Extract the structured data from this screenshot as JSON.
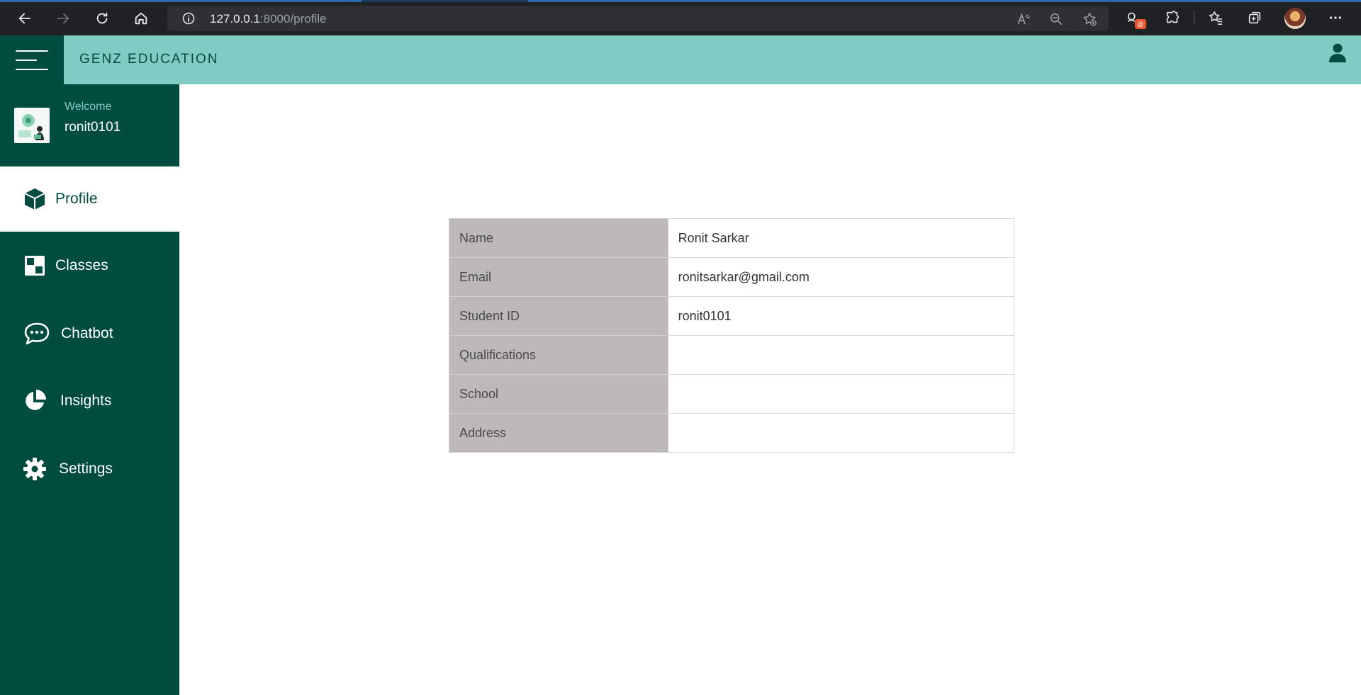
{
  "browser": {
    "url_host": "127.0.0.1",
    "url_path": ":8000/profile",
    "extension_badge": "@"
  },
  "header": {
    "brand": "GENZ EDUCATION"
  },
  "sidebar": {
    "welcome_label": "Welcome",
    "username": "ronit0101",
    "items": [
      {
        "label": "Profile",
        "icon": "cube-icon",
        "active": true
      },
      {
        "label": "Classes",
        "icon": "classes-icon"
      },
      {
        "label": "Chatbot",
        "icon": "chat-icon"
      },
      {
        "label": "Insights",
        "icon": "pie-chart-icon"
      },
      {
        "label": "Settings",
        "icon": "gear-icon"
      }
    ]
  },
  "profile": {
    "rows": [
      {
        "key": "Name",
        "value": "Ronit Sarkar"
      },
      {
        "key": "Email",
        "value": "ronitsarkar@gmail.com"
      },
      {
        "key": "Student ID",
        "value": "ronit0101"
      },
      {
        "key": "Qualifications",
        "value": ""
      },
      {
        "key": "School",
        "value": ""
      },
      {
        "key": "Address",
        "value": ""
      }
    ]
  },
  "colors": {
    "sidebar": "#004d40",
    "header": "#80cbc4",
    "table_key_bg": "#bdb9b9"
  }
}
